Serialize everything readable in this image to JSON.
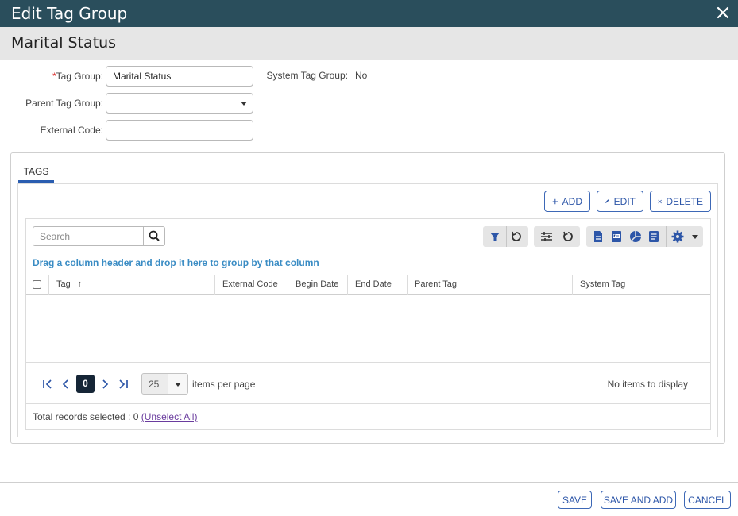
{
  "dialog": {
    "title": "Edit Tag Group",
    "close_icon": "close-icon"
  },
  "record": {
    "name": "Marital Status"
  },
  "form": {
    "tag_group_required": "*",
    "tag_group_label": "Tag Group:",
    "tag_group_value": "Marital Status",
    "system_tag_group_label": "System Tag Group:",
    "system_tag_group_value": "No",
    "parent_tag_group_label": "Parent Tag Group:",
    "parent_tag_group_value": "",
    "external_code_label": "External Code:",
    "external_code_value": ""
  },
  "tabs": [
    {
      "label": "TAGS",
      "active": true
    }
  ],
  "actions": {
    "add": "ADD",
    "edit": "EDIT",
    "delete": "DELETE"
  },
  "grid": {
    "search_placeholder": "Search",
    "group_hint": "Drag a column header and drop it here to group by that column",
    "sort_indicator": "↑",
    "columns": [
      "Tag",
      "External Code",
      "Begin Date",
      "End Date",
      "Parent Tag",
      "System Tag"
    ],
    "rows": [],
    "toolbar_icons": [
      "filter-icon",
      "reset-filter-icon",
      "column-settings-icon",
      "reset-columns-icon",
      "export-document-icon",
      "export-pdf-icon",
      "chart-icon",
      "report-icon",
      "settings-gear-icon"
    ]
  },
  "pager": {
    "current_page": "0",
    "page_size": "25",
    "items_per_page_label": "items per page",
    "status": "No items to display"
  },
  "selection": {
    "text": "Total records selected : 0",
    "unselect_label": "(Unselect All)"
  },
  "footer_buttons": {
    "save": "SAVE",
    "save_and_add": "SAVE AND ADD",
    "cancel": "CANCEL"
  },
  "colors": {
    "header": "#2a4e5c",
    "accent": "#2d56a8",
    "hint": "#3a8cc4",
    "link": "#6a3c9e"
  }
}
